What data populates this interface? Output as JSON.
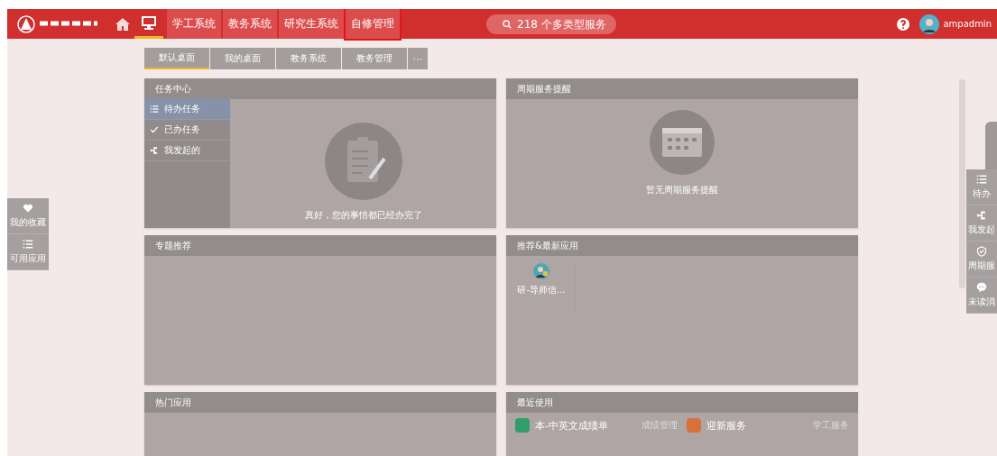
{
  "header": {
    "nav": [
      {
        "label": "学工系统",
        "selected": false,
        "outlined": false
      },
      {
        "label": "教务系统",
        "selected": false,
        "outlined": false
      },
      {
        "label": "研究生系统",
        "selected": false,
        "outlined": false
      },
      {
        "label": "自修管理",
        "selected": false,
        "outlined": true
      }
    ],
    "search": {
      "placeholder": "218 个多类型服务"
    },
    "user": {
      "name": "ampadmin"
    }
  },
  "desk_tabs": [
    {
      "label": "默认桌面",
      "selected": true
    },
    {
      "label": "我的桌面",
      "selected": false
    },
    {
      "label": "教务系统",
      "selected": false
    },
    {
      "label": "教务管理",
      "selected": false
    }
  ],
  "more_tab": "···",
  "left_dock": [
    {
      "kind": "heart",
      "label": "我的收藏"
    },
    {
      "kind": "list",
      "label": "可用应用"
    }
  ],
  "right_dock": [
    {
      "kind": "list",
      "label": "待办"
    },
    {
      "kind": "tree",
      "label": "我发起"
    },
    {
      "kind": "shield",
      "label": "周期服"
    },
    {
      "kind": "chat",
      "label": "未读消"
    }
  ],
  "cards": [
    {
      "kind": "tasks",
      "title": "任务中心",
      "menu": [
        {
          "kind": "list",
          "label": "待办任务",
          "selected": true
        },
        {
          "kind": "check",
          "label": "已办任务",
          "selected": false
        },
        {
          "kind": "tree",
          "label": "我发起的",
          "selected": false
        }
      ],
      "empty_text": "真好，您的事情都已经办完了"
    },
    {
      "kind": "reminder",
      "title": "周期服务提醒",
      "empty_text": "暂无周期服务提醒"
    },
    {
      "kind": "blank",
      "title": "专题推荐"
    },
    {
      "kind": "apps",
      "title": "推荐&最新应用",
      "apps": [
        {
          "name": "研-导师信..."
        }
      ]
    },
    {
      "kind": "blank",
      "title": "热门应用"
    },
    {
      "kind": "recent",
      "title": "最近使用",
      "items": [
        {
          "name": "本-中英文成绩单",
          "category": "成绩管理",
          "color": "#2f9e6a"
        },
        {
          "name": "迎新服务",
          "category": "学工服务",
          "color": "#d9703a"
        }
      ]
    }
  ]
}
